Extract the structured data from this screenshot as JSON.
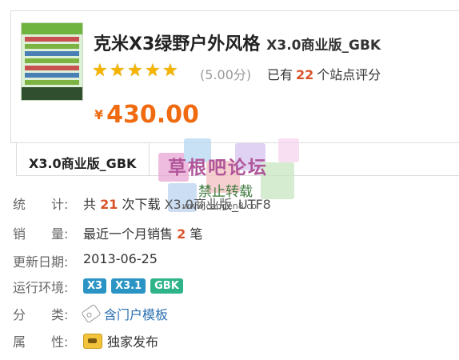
{
  "product": {
    "title": "克米X3绿野户外风格",
    "edition": "X3.0商业版_GBK",
    "rating_score": "(5.00分)",
    "rating_prefix": "已有",
    "rating_count": "22",
    "rating_suffix": "个站点评分",
    "currency": "¥",
    "price": "430.00",
    "stars": 5
  },
  "tab": {
    "label": "X3.0商业版_GBK"
  },
  "watermark": {
    "title": "草根吧论坛",
    "sub": "禁止转载",
    "url": "www.caogen8.co"
  },
  "info": {
    "stats_label": "统　　计:",
    "stats_prefix": "共",
    "stats_count": "21",
    "stats_suffix": "次下载",
    "stats_extra": "X3.0商业版_UTF8",
    "sales_label": "销　　量:",
    "sales_prefix": "最近一个月销售",
    "sales_count": "2",
    "sales_suffix": "笔",
    "updated_label": "更新日期:",
    "updated_value": "2013-06-25",
    "env_label": "运行环境:",
    "env_tags": [
      "X3",
      "X3.1",
      "GBK"
    ],
    "category_label": "分　　类:",
    "category_value": "含门户模板",
    "attr_label": "属　　性:",
    "attr_value": "独家发布"
  },
  "colors": {
    "price": "#f06a0f",
    "highlight": "#d9532a",
    "tag_blue": "#2a95c4",
    "tag_green": "#2fb48a",
    "star": "#f5b400"
  }
}
